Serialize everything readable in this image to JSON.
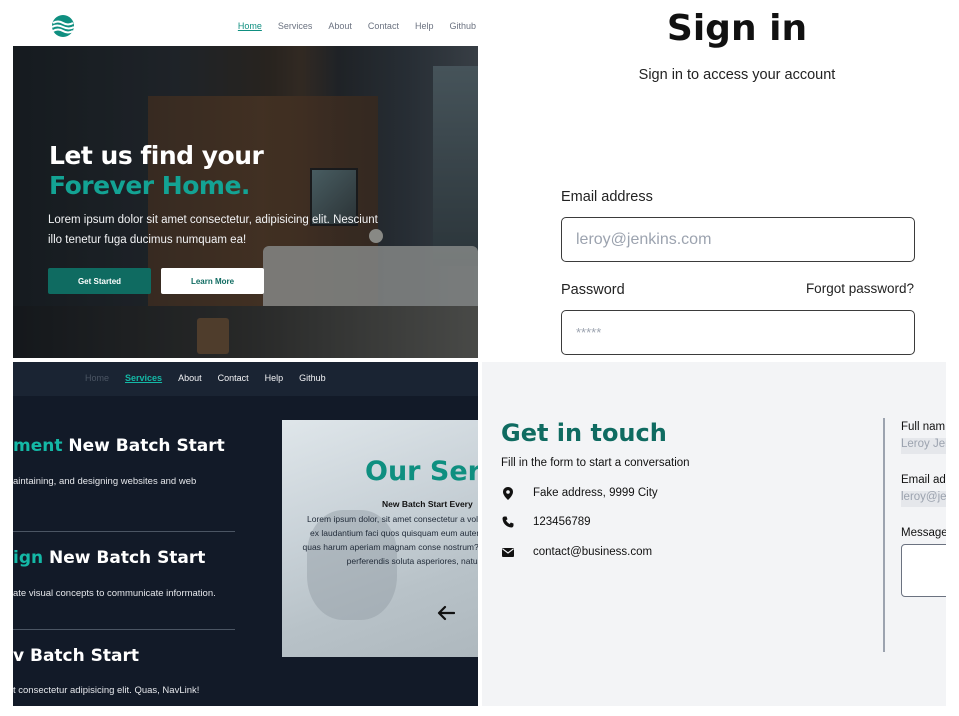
{
  "landing": {
    "nav": {
      "links": [
        "Home",
        "Services",
        "About",
        "Contact",
        "Help",
        "Github"
      ],
      "active": "Home"
    },
    "hero": {
      "title_line1": "Let us find your",
      "title_line2": "Forever Home.",
      "paragraph": "Lorem ipsum dolor sit amet consectetur, adipisicing elit. Nesciunt illo tenetur fuga ducimus numquam ea!",
      "primary_button": "Get Started",
      "secondary_button": "Learn More"
    },
    "colors": {
      "accent": "#13a394",
      "button": "#0f6b61"
    }
  },
  "signin": {
    "title": "Sign in",
    "subtitle": "Sign in to access your account",
    "email_label": "Email address",
    "email_placeholder": "leroy@jenkins.com",
    "password_label": "Password",
    "forgot_link": "Forgot password?",
    "password_placeholder": "*****"
  },
  "services": {
    "nav": {
      "links": [
        "Home",
        "Services",
        "About",
        "Contact",
        "Help",
        "Github"
      ],
      "active": "Services"
    },
    "items": [
      {
        "accent": "ment",
        "title": " New Batch Start",
        "desc": "aintaining, and designing websites and web"
      },
      {
        "accent": "ign",
        "title": " New Batch Start",
        "desc": "ate visual concepts to communicate information."
      },
      {
        "accent": "",
        "title": "v Batch Start",
        "desc": "t consectetur adipisicing elit. Quas, NavLink!"
      }
    ],
    "card": {
      "title": "Our Serv",
      "subtitle": "New Batch Start Every",
      "body": "Lorem ipsum dolor, sit amet consectetur a voluptatem possimus ex laudantium faci quos quisquam eum autem pariatur iste qui quas harum aperiam magnam conse nostrum? Sapiente vel, amet perferendis soluta asperiores, natus itaque",
      "arrow_icon": "arrow-left-icon"
    }
  },
  "contact": {
    "title": "Get in touch",
    "subtitle": "Fill in the form to start a conversation",
    "items": [
      {
        "icon": "location-pin-icon",
        "text": "Fake address, 9999 City"
      },
      {
        "icon": "phone-icon",
        "text": "123456789"
      },
      {
        "icon": "envelope-icon",
        "text": "contact@business.com"
      }
    ],
    "form": {
      "fullname_label": "Full nam",
      "fullname_placeholder": "Leroy Jer",
      "email_label": "Email ad",
      "email_placeholder": "leroy@je",
      "message_label": "Message"
    }
  }
}
